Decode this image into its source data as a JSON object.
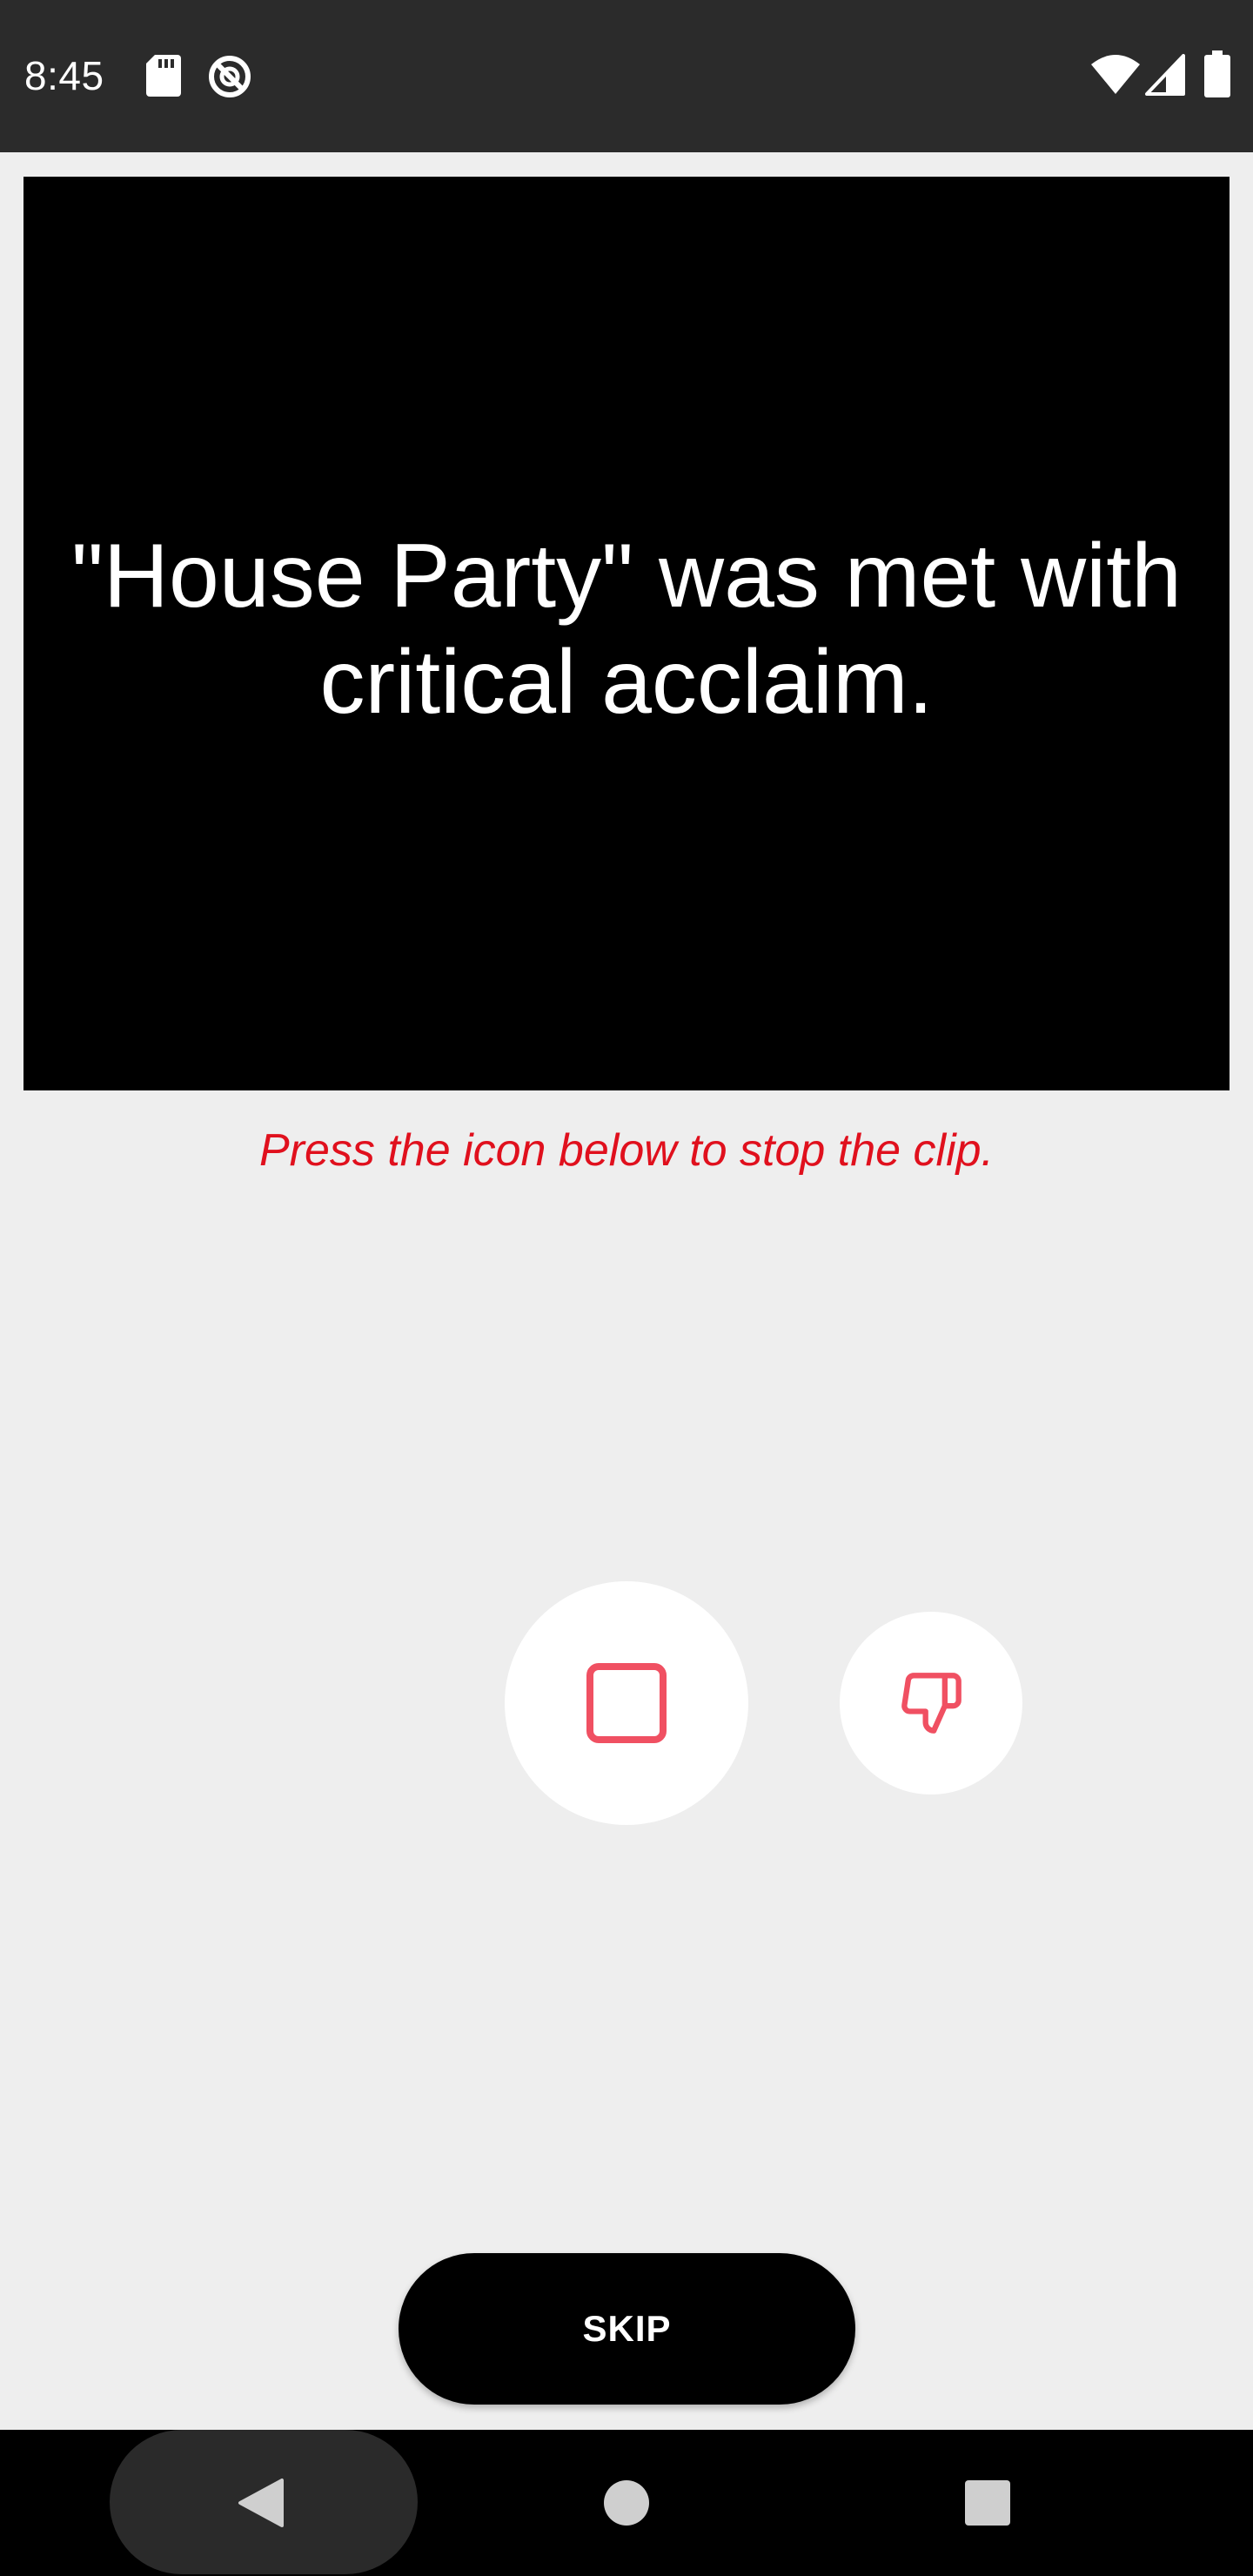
{
  "status_bar": {
    "time": "8:45",
    "icons": [
      "sd-card-icon",
      "sync-disabled-icon",
      "wifi-icon",
      "cell-signal-icon",
      "battery-icon"
    ]
  },
  "clip": {
    "caption": "\"House Party\" was met with critical acclaim."
  },
  "instruction": {
    "text": "Press the icon below to stop the clip."
  },
  "actions": {
    "stop_icon": "stop-square-icon",
    "dislike_icon": "thumbs-down-icon",
    "accent_color": "#f05062"
  },
  "skip": {
    "label": "SKIP"
  },
  "nav_bar": {
    "icons": [
      "back-icon",
      "home-icon",
      "recents-icon"
    ]
  },
  "colors": {
    "background": "#eeeeee",
    "status_bar": "#2b2b2b",
    "instruction": "#e0101d",
    "clip_background": "#000000"
  }
}
